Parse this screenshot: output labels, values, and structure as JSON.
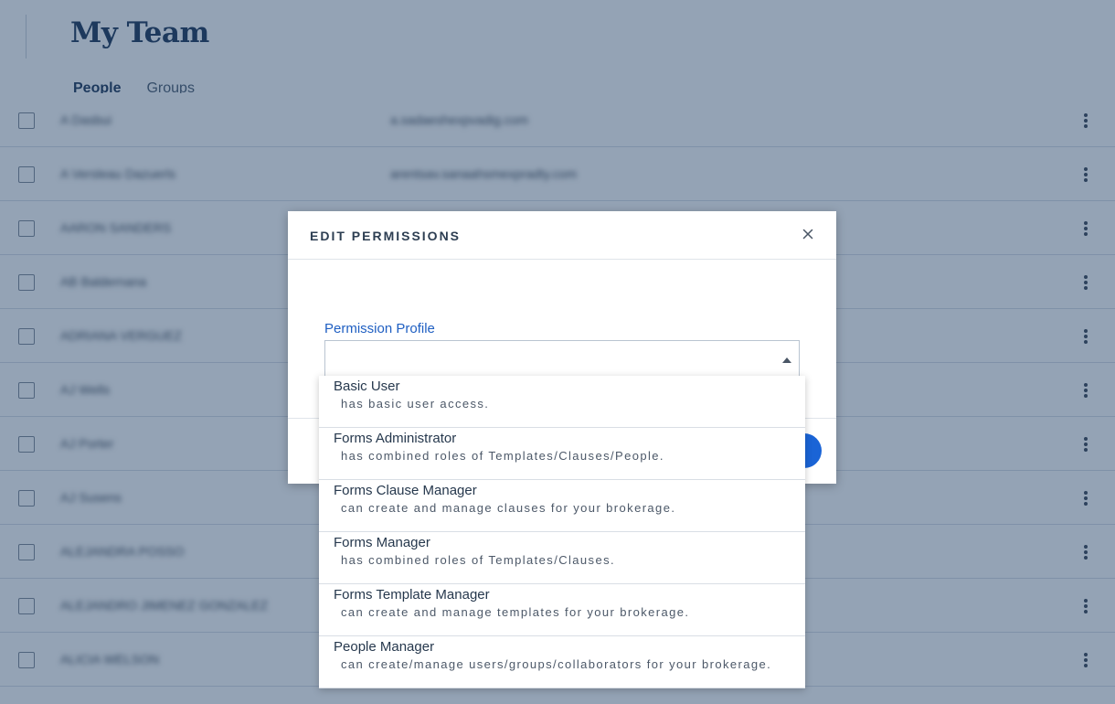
{
  "page": {
    "title": "My Team",
    "tabs": [
      {
        "label": "People",
        "active": true
      },
      {
        "label": "Groups",
        "active": false
      }
    ]
  },
  "table": {
    "rows": [
      {
        "name": "A Dasbui",
        "email": "a.sadaeshexpvadig.com"
      },
      {
        "name": "A Versleau Dazuerls",
        "email": "arentsav.sanaahsmexpradty.com"
      },
      {
        "name": "AARON SANDERS",
        "email": ""
      },
      {
        "name": "AB Baldernana",
        "email": ""
      },
      {
        "name": "ADRIANA VERGUEZ",
        "email": ""
      },
      {
        "name": "AJ Wells",
        "email": ""
      },
      {
        "name": "AJ Porter",
        "email": ""
      },
      {
        "name": "AJ Susens",
        "email": ""
      },
      {
        "name": "ALEJANDRA POSSO",
        "email": ""
      },
      {
        "name": "ALEJANDRO JIMENEZ GONZALEZ",
        "email": ""
      },
      {
        "name": "ALICIA WELSON",
        "email": ""
      }
    ]
  },
  "modal": {
    "title": "EDIT PERMISSIONS",
    "field_label": "Permission Profile",
    "select_value": ""
  },
  "dropdown": {
    "options": [
      {
        "title": "Basic User",
        "description": "has basic user access."
      },
      {
        "title": "Forms Administrator",
        "description": "has combined roles of Templates/Clauses/People."
      },
      {
        "title": "Forms Clause Manager",
        "description": "can create and manage clauses for your brokerage."
      },
      {
        "title": "Forms Manager",
        "description": "has combined roles of Templates/Clauses."
      },
      {
        "title": "Forms Template Manager",
        "description": "can create and manage templates for your brokerage."
      },
      {
        "title": "People Manager",
        "description": "can create/manage users/groups/collaborators for your brokerage."
      }
    ]
  },
  "colors": {
    "accent": "#1a64d6",
    "title_text": "#1b3457",
    "overlay": "#203e64"
  },
  "icons": {
    "close": "close-icon",
    "caret": "caret-up-icon",
    "row_menu": "more-vertical-icon"
  }
}
